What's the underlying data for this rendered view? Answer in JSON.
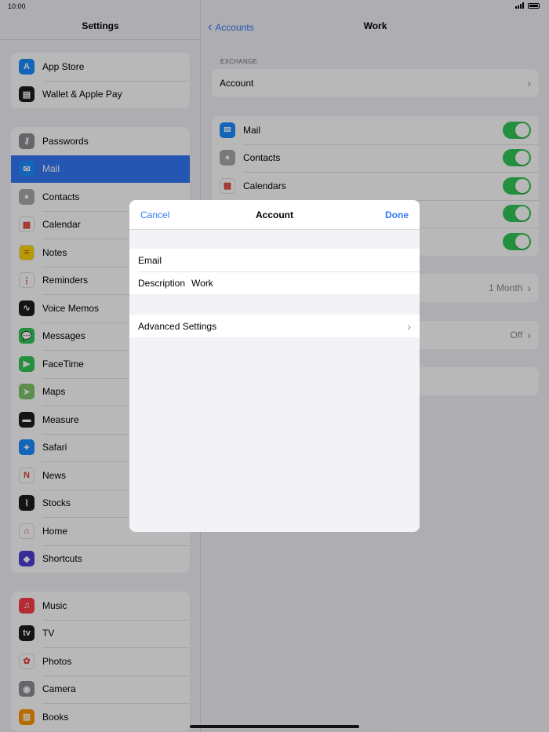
{
  "status": {
    "time": "10:00"
  },
  "sidebar": {
    "title": "Settings",
    "groups": [
      [
        {
          "label": "App Store",
          "icon": "app-store-icon",
          "color": "#1a8cff",
          "glyph": "A"
        },
        {
          "label": "Wallet & Apple Pay",
          "icon": "wallet-icon",
          "color": "#1c1c1e",
          "glyph": "▤"
        }
      ],
      [
        {
          "label": "Passwords",
          "icon": "key-icon",
          "color": "#8e8e93",
          "glyph": "⚷"
        },
        {
          "label": "Mail",
          "icon": "mail-icon",
          "color": "#1a8cff",
          "glyph": "✉"
        },
        {
          "label": "Contacts",
          "icon": "contacts-icon",
          "color": "#a9a9ad",
          "glyph": "●"
        },
        {
          "label": "Calendar",
          "icon": "calendar-icon",
          "color": "#ffffff",
          "glyph": "▦"
        },
        {
          "label": "Notes",
          "icon": "notes-icon",
          "color": "#ffd60a",
          "glyph": "≡"
        },
        {
          "label": "Reminders",
          "icon": "reminders-icon",
          "color": "#ffffff",
          "glyph": "⋮"
        },
        {
          "label": "Voice Memos",
          "icon": "voice-memos-icon",
          "color": "#1c1c1e",
          "glyph": "∿"
        },
        {
          "label": "Messages",
          "icon": "messages-icon",
          "color": "#34c759",
          "glyph": "💬"
        },
        {
          "label": "FaceTime",
          "icon": "facetime-icon",
          "color": "#34c759",
          "glyph": "▶"
        },
        {
          "label": "Maps",
          "icon": "maps-icon",
          "color": "#7ec46a",
          "glyph": "➤"
        },
        {
          "label": "Measure",
          "icon": "measure-icon",
          "color": "#1c1c1e",
          "glyph": "▬"
        },
        {
          "label": "Safari",
          "icon": "safari-icon",
          "color": "#1a8cff",
          "glyph": "✦"
        },
        {
          "label": "News",
          "icon": "news-icon",
          "color": "#ffffff",
          "glyph": "N"
        },
        {
          "label": "Stocks",
          "icon": "stocks-icon",
          "color": "#1c1c1e",
          "glyph": "⌇"
        },
        {
          "label": "Home",
          "icon": "home-icon",
          "color": "#ffffff",
          "glyph": "⌂"
        },
        {
          "label": "Shortcuts",
          "icon": "shortcuts-icon",
          "color": "#4b3fd6",
          "glyph": "◆"
        }
      ],
      [
        {
          "label": "Music",
          "icon": "music-icon",
          "color": "#fa3c4c",
          "glyph": "♫"
        },
        {
          "label": "TV",
          "icon": "tv-icon",
          "color": "#1c1c1e",
          "glyph": "tv"
        },
        {
          "label": "Photos",
          "icon": "photos-icon",
          "color": "#ffffff",
          "glyph": "✿"
        },
        {
          "label": "Camera",
          "icon": "camera-icon",
          "color": "#8e8e93",
          "glyph": "◉"
        },
        {
          "label": "Books",
          "icon": "books-icon",
          "color": "#ff9500",
          "glyph": "▥"
        }
      ]
    ]
  },
  "detail": {
    "back_label": "Accounts",
    "title": "Work",
    "section_label": "EXCHANGE",
    "account_label": "Account",
    "toggles": [
      {
        "label": "Mail",
        "icon": "mail-icon",
        "color": "#1a8cff",
        "glyph": "✉"
      },
      {
        "label": "Contacts",
        "icon": "contacts-icon",
        "color": "#a9a9ad",
        "glyph": "●"
      },
      {
        "label": "Calendars",
        "icon": "calendar-icon",
        "color": "#ffffff",
        "glyph": "▦"
      },
      {
        "label": "",
        "icon": "",
        "color": "",
        "glyph": ""
      },
      {
        "label": "",
        "icon": "",
        "color": "",
        "glyph": ""
      }
    ],
    "sync_value": "1 Month",
    "auto_reply_value": "Off"
  },
  "modal": {
    "cancel_label": "Cancel",
    "title": "Account",
    "done_label": "Done",
    "email_label": "Email",
    "email_value": "",
    "description_label": "Description",
    "description_value": "Work",
    "advanced_label": "Advanced Settings"
  },
  "colors": {
    "accent": "#3478f6",
    "toggle_on": "#34c759"
  }
}
